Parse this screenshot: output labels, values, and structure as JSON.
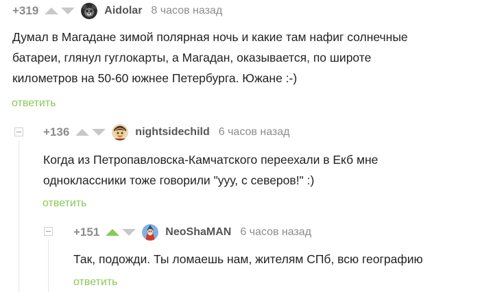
{
  "comments": [
    {
      "rating": "+319",
      "author": "Aidolar",
      "time": "8 часов назад",
      "lines": [
        "Думал в Магадане зимой полярная ночь и какие там нафиг солнечные",
        "батареи, глянул гуглокарты, а Магадан, оказывается, по широте",
        "километров на 50-60 южнее Петербурга. Южане :-)"
      ],
      "reply_label": "ответить",
      "avatar_icon": "bear-avatar-icon",
      "upvoted": false
    },
    {
      "rating": "+136",
      "author": "nightsidechild",
      "time": "6 часов назад",
      "lines": [
        "Когда из Петропавловска-Камчатского переехали в Екб мне",
        "одноклассники тоже говорили \"ууу, с северов!\" :)"
      ],
      "reply_label": "ответить",
      "avatar_icon": "character-avatar-icon",
      "upvoted": false
    },
    {
      "rating": "+151",
      "author": "NeoShaMAN",
      "time": "6 часов назад",
      "lines": [
        "Так, подожди. Ты ломаешь нам, жителям СПб, всю географию"
      ],
      "reply_label": "ответить",
      "avatar_icon": "wizard-avatar-icon",
      "upvoted": true
    }
  ],
  "colors": {
    "accent_green": "#8ac858",
    "muted_gray": "#8b8b8b",
    "text": "#222222"
  }
}
